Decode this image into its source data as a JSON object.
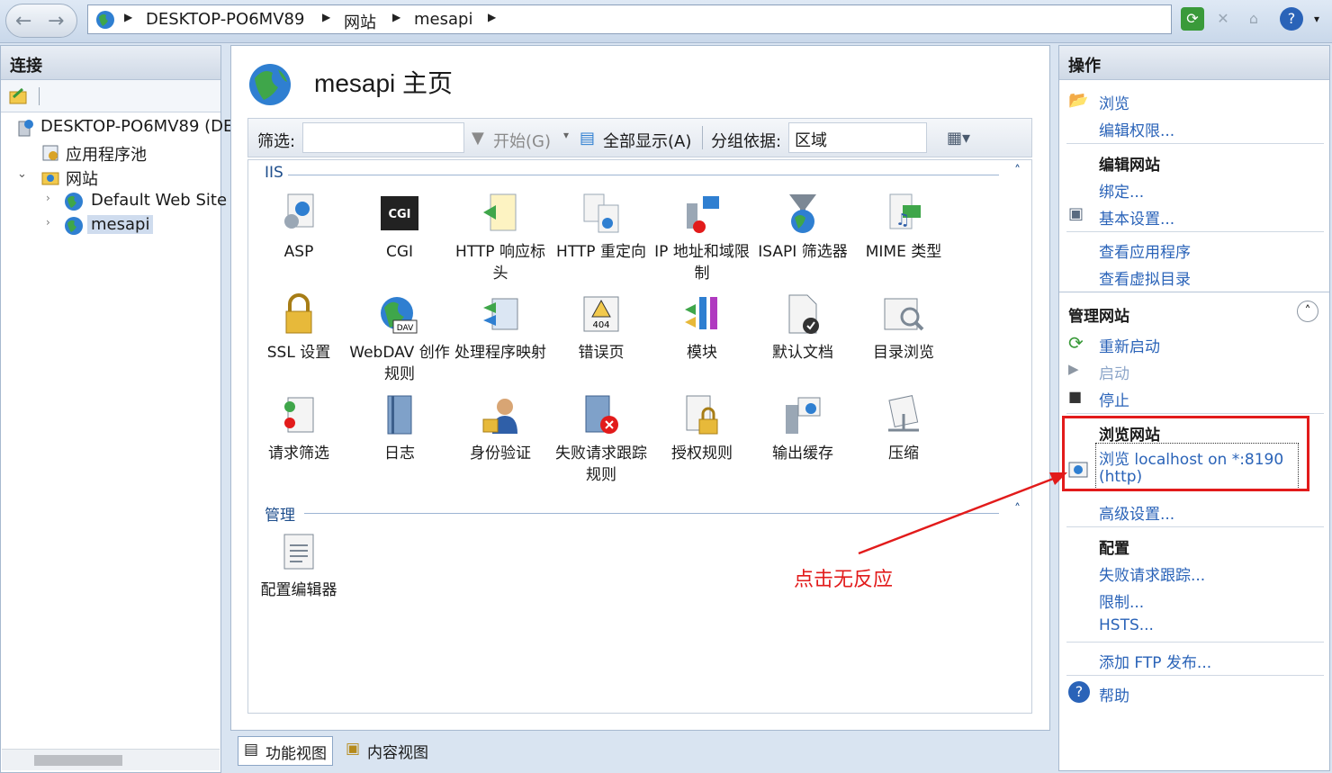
{
  "breadcrumb": {
    "items": [
      "DESKTOP-PO6MV89",
      "网站",
      "mesapi"
    ]
  },
  "left_pane": {
    "title": "连接",
    "tree": [
      {
        "label": "DESKTOP-PO6MV89 (DE",
        "icon": "server-icon"
      },
      {
        "label": "应用程序池",
        "icon": "app-pool-icon"
      },
      {
        "label": "网站",
        "icon": "sites-folder-icon"
      },
      {
        "label": "Default Web Site",
        "icon": "globe-icon"
      },
      {
        "label": "mesapi",
        "icon": "globe-icon"
      }
    ]
  },
  "main": {
    "title": "mesapi 主页",
    "filter": {
      "label": "筛选:",
      "value": "",
      "start": "开始(G)",
      "show_all": "全部显示(A)",
      "group_by_label": "分组依据:",
      "group_by_value": "区域"
    },
    "groups": [
      {
        "name": "IIS",
        "features": [
          {
            "label": "ASP",
            "icon": "asp-icon"
          },
          {
            "label": "CGI",
            "icon": "cgi-icon"
          },
          {
            "label": "HTTP 响应标头",
            "icon": "http-response-headers-icon"
          },
          {
            "label": "HTTP 重定向",
            "icon": "http-redirect-icon"
          },
          {
            "label": "IP 地址和域限制",
            "icon": "ip-restrictions-icon"
          },
          {
            "label": "ISAPI 筛选器",
            "icon": "isapi-filters-icon"
          },
          {
            "label": "MIME 类型",
            "icon": "mime-types-icon"
          },
          {
            "label": "SSL 设置",
            "icon": "ssl-lock-icon"
          },
          {
            "label": "WebDAV 创作规则",
            "icon": "webdav-icon"
          },
          {
            "label": "处理程序映射",
            "icon": "handler-mappings-icon"
          },
          {
            "label": "错误页",
            "icon": "error-pages-icon"
          },
          {
            "label": "模块",
            "icon": "modules-icon"
          },
          {
            "label": "默认文档",
            "icon": "default-document-icon"
          },
          {
            "label": "目录浏览",
            "icon": "directory-browsing-icon"
          },
          {
            "label": "请求筛选",
            "icon": "request-filtering-icon"
          },
          {
            "label": "日志",
            "icon": "logging-icon"
          },
          {
            "label": "身份验证",
            "icon": "authentication-icon"
          },
          {
            "label": "失败请求跟踪规则",
            "icon": "failed-request-tracing-icon"
          },
          {
            "label": "授权规则",
            "icon": "authorization-rules-icon"
          },
          {
            "label": "输出缓存",
            "icon": "output-caching-icon"
          },
          {
            "label": "压缩",
            "icon": "compression-icon"
          }
        ]
      },
      {
        "name": "管理",
        "features": [
          {
            "label": "配置编辑器",
            "icon": "configuration-editor-icon"
          }
        ]
      }
    ]
  },
  "bottom_tabs": [
    "功能视图",
    "内容视图"
  ],
  "actions": {
    "title": "操作",
    "browse": "浏览",
    "edit_permissions": "编辑权限...",
    "edit_site_head": "编辑网站",
    "bindings": "绑定...",
    "basic_settings": "基本设置...",
    "view_apps": "查看应用程序",
    "view_vdirs": "查看虚拟目录",
    "manage_site_head": "管理网站",
    "restart": "重新启动",
    "start": "启动",
    "stop": "停止",
    "browse_site_head": "浏览网站",
    "browse_localhost_1": "浏览 localhost on *:8190",
    "browse_localhost_2": "(http)",
    "advanced_settings": "高级设置...",
    "config_head": "配置",
    "failed_request_tracing": "失败请求跟踪...",
    "limits": "限制...",
    "hsts": "HSTS...",
    "add_ftp": "添加 FTP 发布...",
    "help": "帮助"
  },
  "annotation": {
    "text": "点击无反应",
    "color": "#e21b1b"
  }
}
